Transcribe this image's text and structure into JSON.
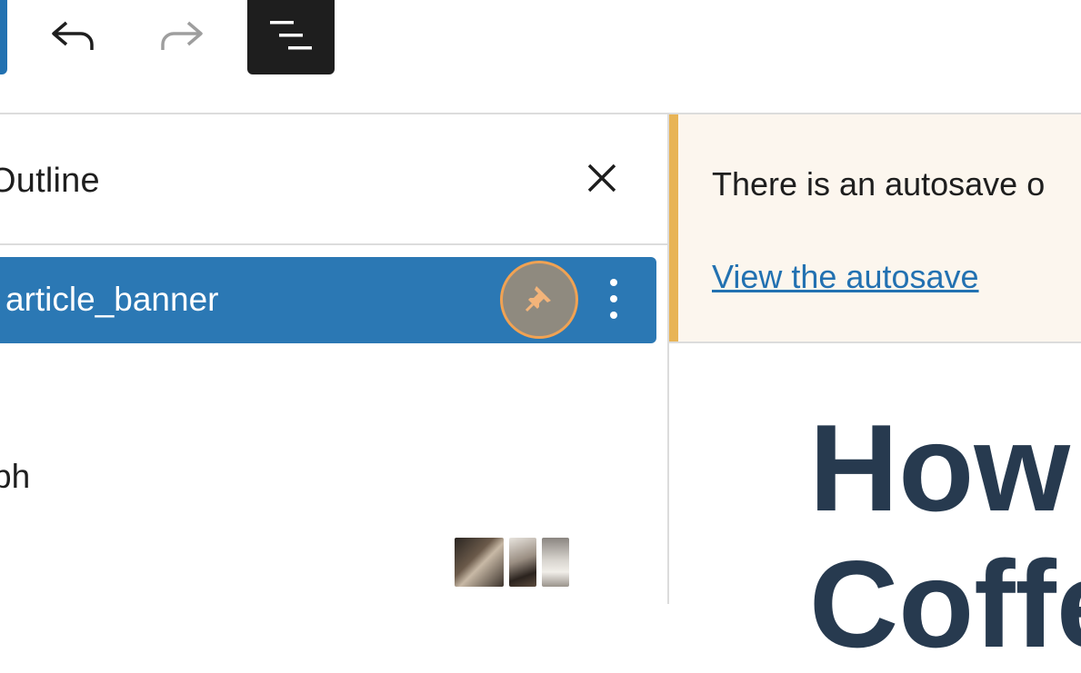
{
  "toolbar": {
    "undo_icon": "undo-icon",
    "redo_icon": "redo-icon",
    "outline_icon": "list-view-icon"
  },
  "outline_panel": {
    "title": "Outline",
    "close_icon": "close-icon",
    "selected_item": {
      "label": "article_banner",
      "pin_icon": "pin-icon",
      "more_icon": "more-vertical-icon"
    },
    "partial_item_label": "ph"
  },
  "notice": {
    "text": "There is an autosave o",
    "link": "View the autosave"
  },
  "editor": {
    "heading_line1": "How",
    "heading_line2": "Coffe"
  },
  "colors": {
    "accent": "#2b78b4",
    "notice_bg": "#fcf6ee",
    "notice_accent": "#e8b456",
    "heading": "#273a4f",
    "link": "#2271b1",
    "pin_focus": "#f0a253"
  }
}
